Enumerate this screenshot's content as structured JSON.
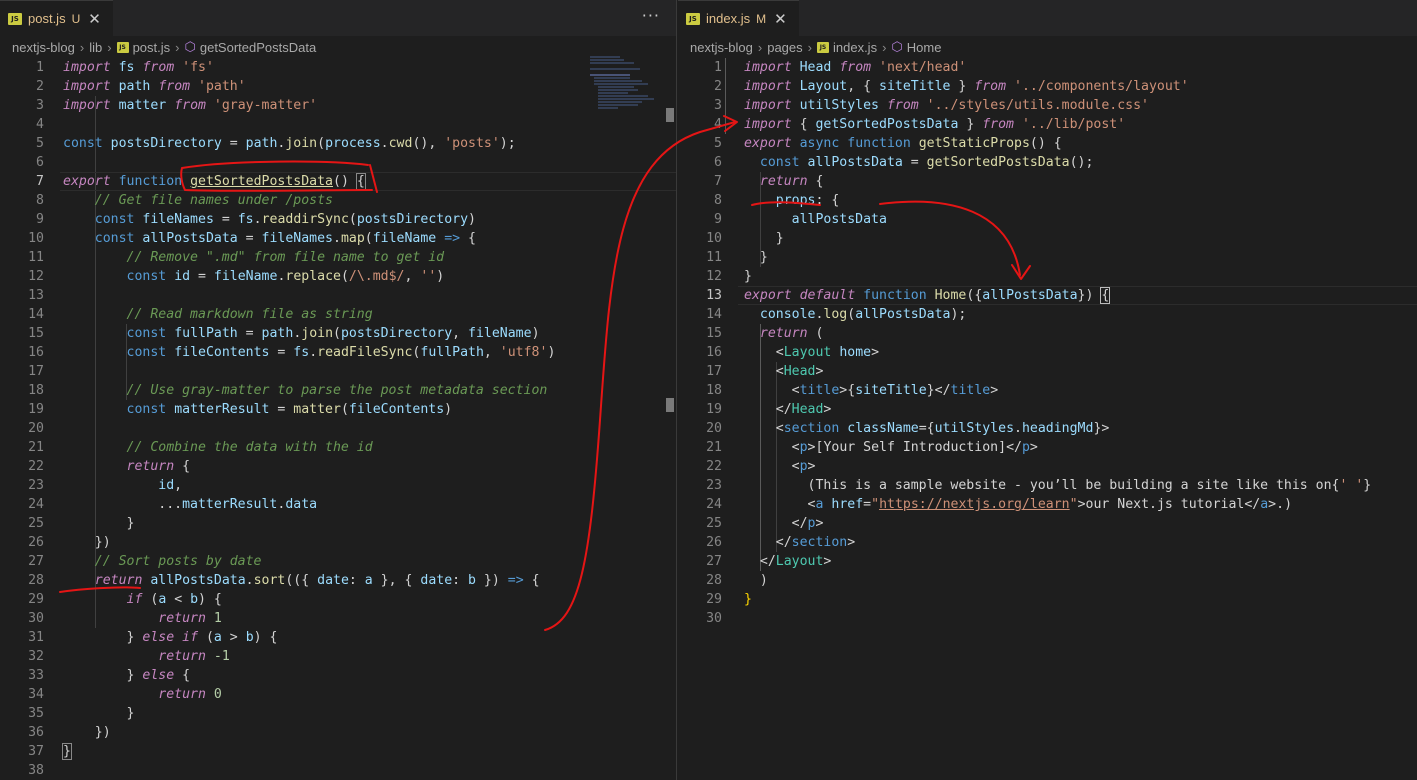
{
  "left": {
    "tab": {
      "icon": "JS",
      "name": "post.js",
      "flag": "U",
      "close": "✕"
    },
    "more": "···",
    "breadcrumb": [
      "nextjs-blog",
      "lib",
      "post.js",
      "getSortedPostsData"
    ]
  },
  "right": {
    "tab": {
      "icon": "JS",
      "name": "index.js",
      "flag": "M",
      "close": "✕"
    },
    "breadcrumb": [
      "nextjs-blog",
      "pages",
      "index.js",
      "Home"
    ]
  },
  "colors": {
    "annotation": "#e51515",
    "background": "#1e1e1e",
    "tabbar": "#252526"
  }
}
